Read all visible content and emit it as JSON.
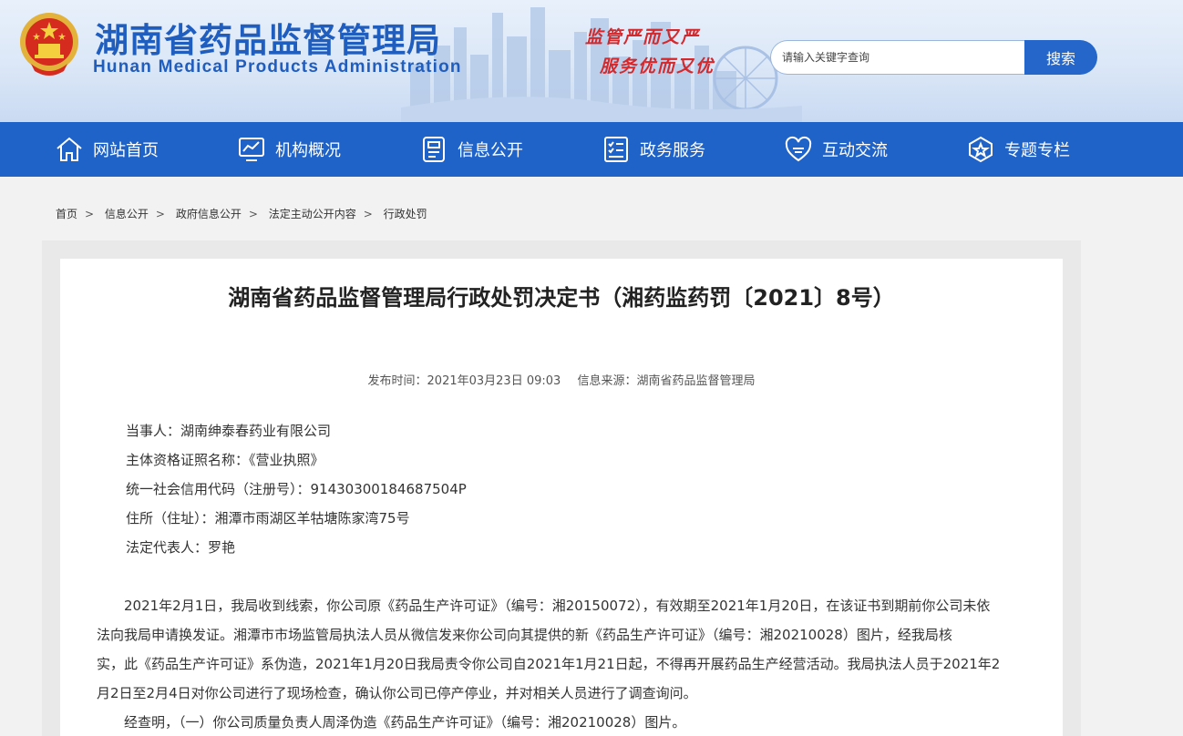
{
  "header": {
    "title": "湖南省药品监督管理局",
    "subtitle": "Hunan Medical Products Administration",
    "slogan_line1": "监管严而又严",
    "slogan_line2": "服务优而又优",
    "search_placeholder": "请输入关键字查询",
    "search_button": "搜索"
  },
  "nav": [
    {
      "label": "网站首页",
      "icon": "home-icon"
    },
    {
      "label": "机构概况",
      "icon": "monitor-chart-icon"
    },
    {
      "label": "信息公开",
      "icon": "document-icon"
    },
    {
      "label": "政务服务",
      "icon": "checklist-icon"
    },
    {
      "label": "互动交流",
      "icon": "heart-chat-icon"
    },
    {
      "label": "专题专栏",
      "icon": "star-badge-icon"
    }
  ],
  "breadcrumb": [
    "首页",
    "信息公开",
    "政府信息公开",
    "法定主动公开内容",
    "行政处罚"
  ],
  "article": {
    "title": "湖南省药品监督管理局行政处罚决定书（湘药监药罚〔2021〕8号）",
    "publish_time": "发布时间：2021年03月23日 09:03",
    "source": "信息来源：湖南省药品监督管理局",
    "fields": [
      "当事人：湖南绅泰春药业有限公司",
      "主体资格证照名称：《营业执照》",
      "统一社会信用代码（注册号）：91430300184687504P",
      "住所（住址）：湘潭市雨湖区羊牯塘陈家湾75号",
      "法定代表人：罗艳"
    ],
    "paragraph_lines": [
      "　　2021年2月1日，我局收到线索，你公司原《药品生产许可证》（编号：湘20150072），有效期至2021年1月20日，在该证书到期前你公司未依",
      "法向我局申请换发证。湘潭市市场监管局执法人员从微信发来你公司向其提供的新《药品生产许可证》（编号：湘20210028）图片，经我局核",
      "实，此《药品生产许可证》系伪造，2021年1月20日我局责令你公司自2021年1月21日起，不得再开展药品生产经营活动。我局执法人员于2021年2",
      "月2日至2月4日对你公司进行了现场检查，确认你公司已停产停业，并对相关人员进行了调查询问。",
      "　　经查明，（一）你公司质量负责人周泽伪造《药品生产许可证》（编号：湘20210028）图片。"
    ]
  },
  "colors": {
    "brand_blue": "#1f62c8",
    "title_blue": "#1f5dbf",
    "slogan_red": "#d3282c"
  }
}
